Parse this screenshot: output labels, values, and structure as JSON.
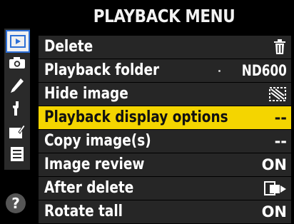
{
  "title": "PLAYBACK MENU",
  "sidebar": {
    "icons": [
      "playback-icon",
      "camera-icon",
      "pencil-icon",
      "wrench-icon",
      "retouch-icon",
      "my-menu-icon"
    ],
    "help_label": "?"
  },
  "menu": {
    "items": [
      {
        "label": "Delete",
        "value": "",
        "value_icon": "trash-icon"
      },
      {
        "label": "Playback folder",
        "value": "ND600"
      },
      {
        "label": "Hide image",
        "value": "",
        "value_icon": "hidden-image-icon"
      },
      {
        "label": "Playback display options",
        "value": "--",
        "selected": true
      },
      {
        "label": "Copy image(s)",
        "value": "--"
      },
      {
        "label": "Image review",
        "value": "ON"
      },
      {
        "label": "After delete",
        "value": "",
        "value_icon": "show-next-icon"
      },
      {
        "label": "Rotate tall",
        "value": "ON"
      }
    ]
  },
  "colors": {
    "selected_row": "#f4d500",
    "row_bg": "#262626",
    "active_tab_border": "#2d6fd6"
  }
}
